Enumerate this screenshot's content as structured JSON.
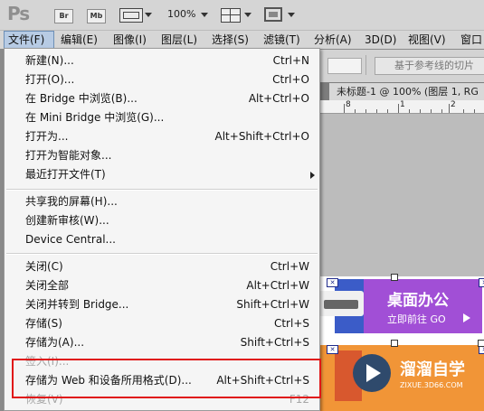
{
  "app": {
    "logo": "Ps",
    "br_label": "Br",
    "mb_label": "Mb",
    "zoom": "100%"
  },
  "menubar": [
    {
      "label": "文件(F)",
      "active": true
    },
    {
      "label": "编辑(E)"
    },
    {
      "label": "图像(I)"
    },
    {
      "label": "图层(L)"
    },
    {
      "label": "选择(S)"
    },
    {
      "label": "滤镜(T)"
    },
    {
      "label": "分析(A)"
    },
    {
      "label": "3D(D)"
    },
    {
      "label": "视图(V)"
    },
    {
      "label": "窗口"
    }
  ],
  "options_bar": {
    "guide_button": "基于参考线的切片"
  },
  "document": {
    "tab_title": "未标题-1 @ 100% (图层 1, RG",
    "ruler": [
      "8",
      "1",
      "2"
    ]
  },
  "artwork": {
    "banner_title": "桌面办公",
    "banner_sub": "立即前往 GO",
    "watermark_title": "溜溜自学",
    "watermark_url": "ZIXUE.3D66.COM"
  },
  "file_menu": {
    "groups": [
      [
        {
          "label": "新建(N)...",
          "shortcut": "Ctrl+N"
        },
        {
          "label": "打开(O)...",
          "shortcut": "Ctrl+O"
        },
        {
          "label": "在 Bridge 中浏览(B)...",
          "shortcut": "Alt+Ctrl+O"
        },
        {
          "label": "在 Mini Bridge 中浏览(G)...",
          "shortcut": ""
        },
        {
          "label": "打开为...",
          "shortcut": "Alt+Shift+Ctrl+O"
        },
        {
          "label": "打开为智能对象...",
          "shortcut": ""
        },
        {
          "label": "最近打开文件(T)",
          "shortcut": "",
          "submenu": true
        }
      ],
      [
        {
          "label": "共享我的屏幕(H)...",
          "shortcut": ""
        },
        {
          "label": "创建新审核(W)...",
          "shortcut": ""
        },
        {
          "label": "Device Central...",
          "shortcut": ""
        }
      ],
      [
        {
          "label": "关闭(C)",
          "shortcut": "Ctrl+W"
        },
        {
          "label": "关闭全部",
          "shortcut": "Alt+Ctrl+W"
        },
        {
          "label": "关闭并转到 Bridge...",
          "shortcut": "Shift+Ctrl+W"
        },
        {
          "label": "存储(S)",
          "shortcut": "Ctrl+S"
        },
        {
          "label": "存储为(A)...",
          "shortcut": "Shift+Ctrl+S"
        },
        {
          "label": "签入(I)...",
          "shortcut": "",
          "disabled": true
        },
        {
          "label": "存储为 Web 和设备所用格式(D)...",
          "shortcut": "Alt+Shift+Ctrl+S",
          "highlighted": true
        },
        {
          "label": "恢复(V)",
          "shortcut": "F12",
          "disabled": true
        }
      ]
    ]
  },
  "colors": {
    "highlight_border": "#e01717",
    "menu_active_bg": "#b7cbe4"
  }
}
